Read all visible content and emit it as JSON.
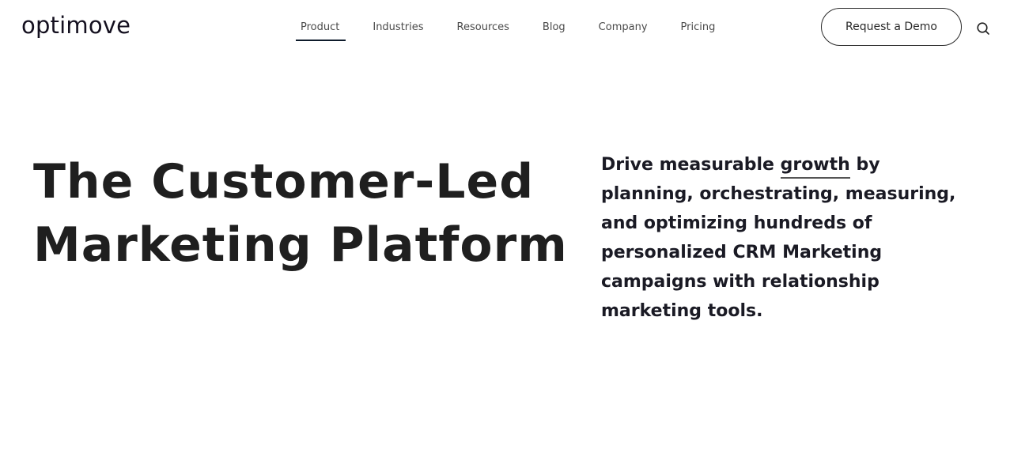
{
  "header": {
    "logo": "optimove",
    "nav": [
      {
        "label": "Product",
        "active": true
      },
      {
        "label": "Industries",
        "active": false
      },
      {
        "label": "Resources",
        "active": false
      },
      {
        "label": "Blog",
        "active": false
      },
      {
        "label": "Company",
        "active": false
      },
      {
        "label": "Pricing",
        "active": false
      }
    ],
    "cta_label": "Request a Demo",
    "search_icon": "search-icon"
  },
  "hero": {
    "title_line1": "The Customer-Led",
    "title_line2": "Marketing Platform",
    "subtitle_before": "Drive measurable ",
    "subtitle_highlight": "growth",
    "subtitle_after": " by planning, orchestrating, measuring, and optimizing hundreds of personalized CRM Marketing campaigns with relationship marketing tools."
  },
  "colors": {
    "text": "#1f1f1f",
    "nav_text": "#4a4a4a",
    "active_underline": "#0e1b2b",
    "background": "#ffffff"
  }
}
